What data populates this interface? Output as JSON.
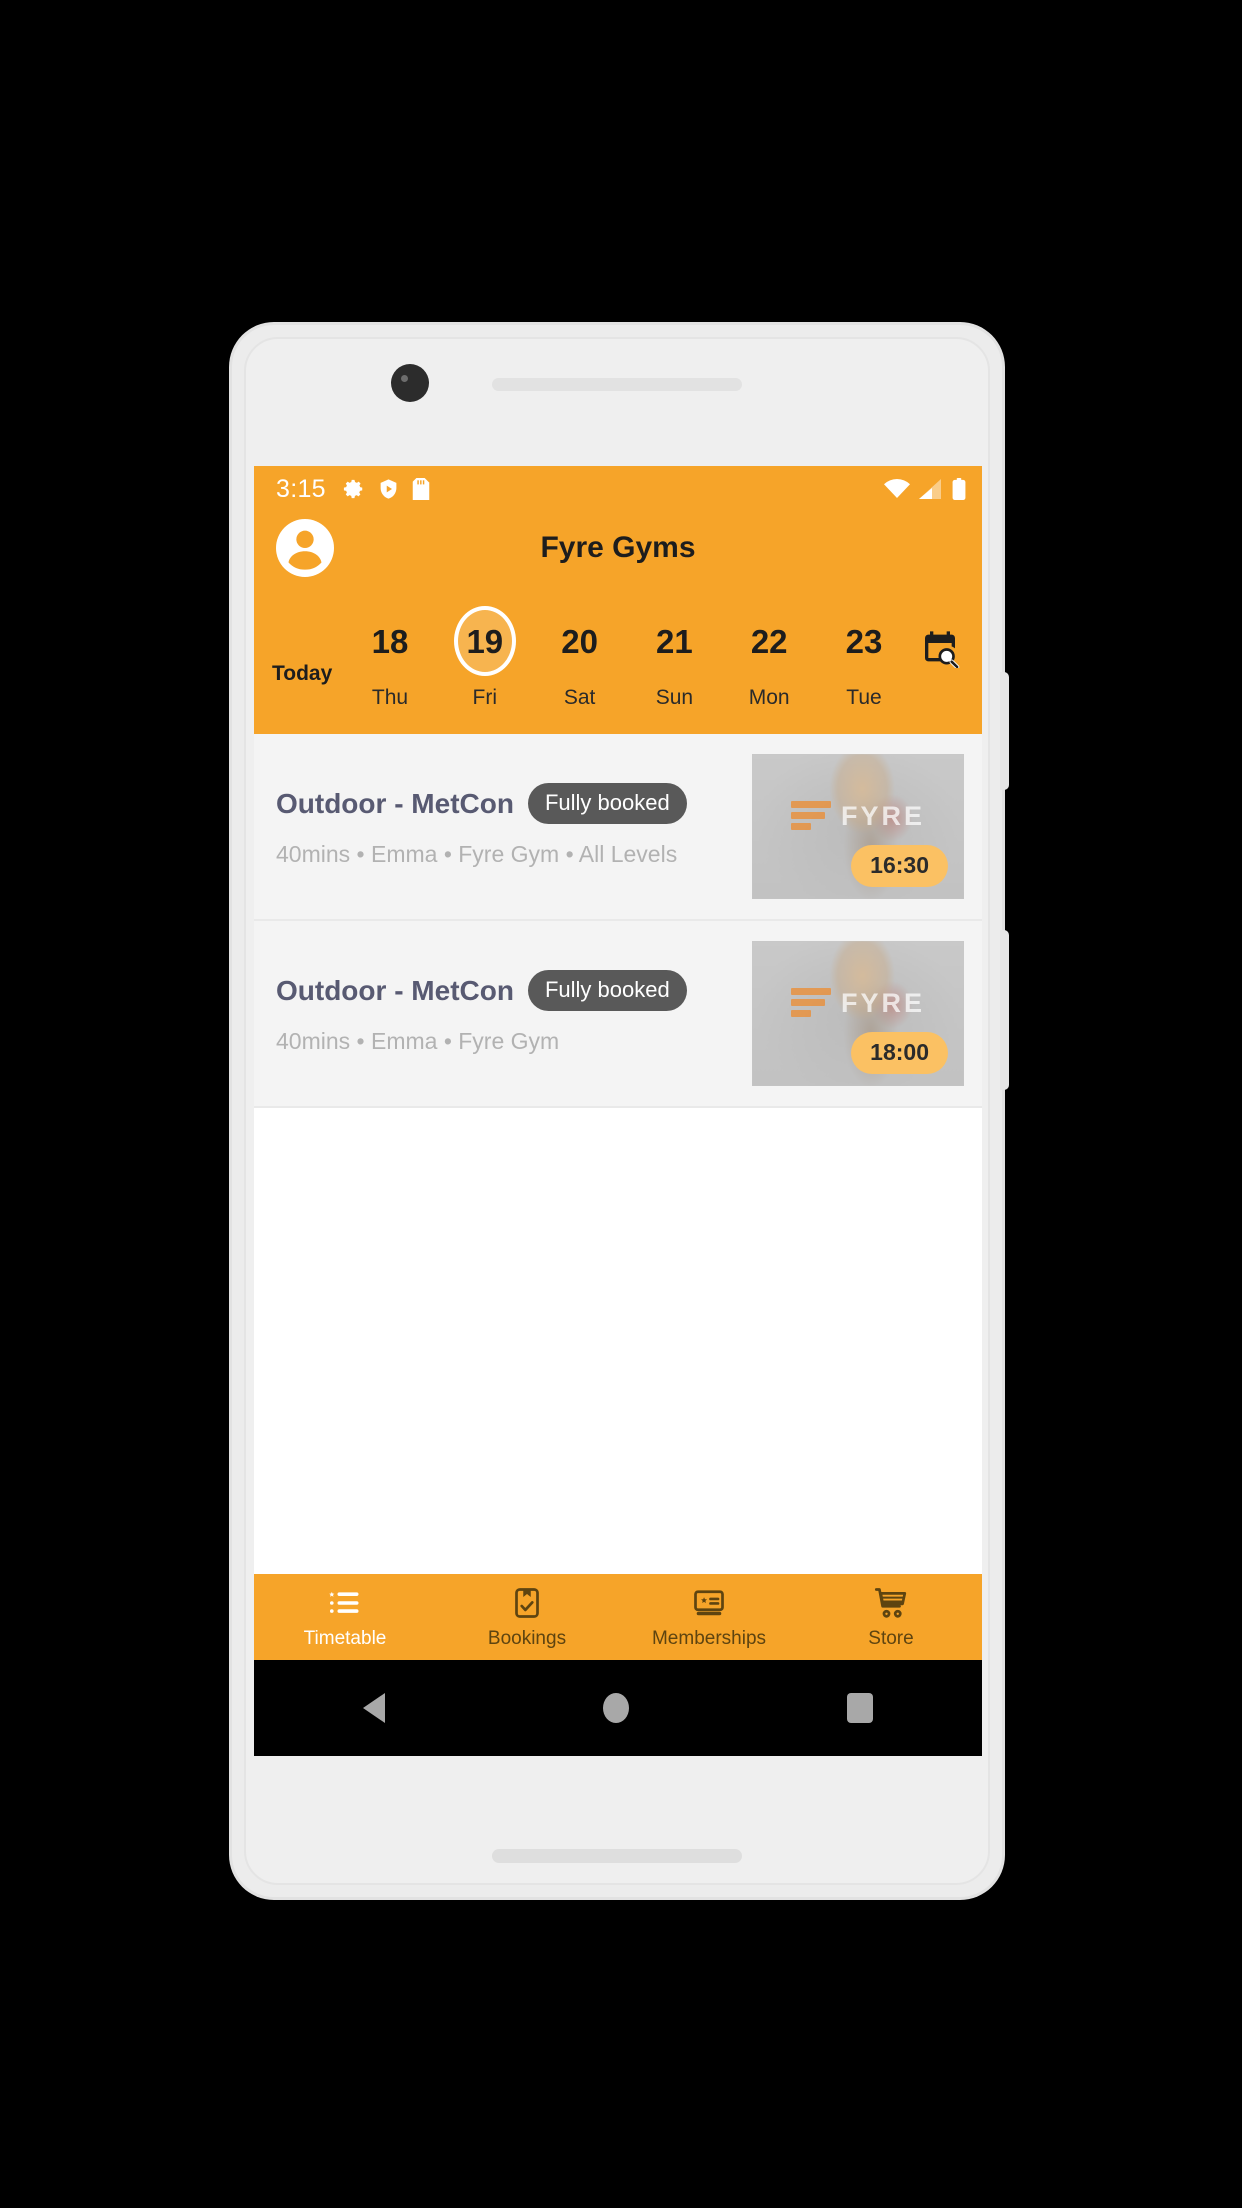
{
  "theme": {
    "brand_orange": "#f6a429",
    "badge_gray": "#595959",
    "title_purple": "#585a72",
    "time_badge_yellow": "#fbc163"
  },
  "status_bar": {
    "time": "3:15",
    "left_icons": [
      "gear-icon",
      "shield-play-icon",
      "sd-card-icon"
    ],
    "right_icons": [
      "wifi-icon",
      "cell-signal-icon",
      "battery-icon"
    ]
  },
  "app_bar": {
    "title": "Fyre Gyms",
    "avatar_icon": "person-avatar-icon"
  },
  "date_strip": {
    "today_label": "Today",
    "calendar_search_icon": "calendar-search-icon",
    "dates": [
      {
        "num": "18",
        "day": "Thu",
        "selected": false
      },
      {
        "num": "19",
        "day": "Fri",
        "selected": true
      },
      {
        "num": "20",
        "day": "Sat",
        "selected": false
      },
      {
        "num": "21",
        "day": "Sun",
        "selected": false
      },
      {
        "num": "22",
        "day": "Mon",
        "selected": false
      },
      {
        "num": "23",
        "day": "Tue",
        "selected": false
      }
    ]
  },
  "classes": [
    {
      "title": "Outdoor - MetCon",
      "badge": "Fully booked",
      "meta": "40mins • Emma • Fyre Gym • All Levels",
      "time": "16:30",
      "thumb_logo_text": "FYRE"
    },
    {
      "title": "Outdoor - MetCon",
      "badge": "Fully booked",
      "meta": "40mins • Emma • Fyre Gym",
      "time": "18:00",
      "thumb_logo_text": "FYRE"
    }
  ],
  "bottom_nav": [
    {
      "label": "Timetable",
      "icon": "list-star-icon",
      "active": true
    },
    {
      "label": "Bookings",
      "icon": "clipboard-check-icon",
      "active": false
    },
    {
      "label": "Memberships",
      "icon": "membership-card-icon",
      "active": false
    },
    {
      "label": "Store",
      "icon": "shopping-cart-icon",
      "active": false
    }
  ],
  "system_nav": {
    "back": "back-triangle-icon",
    "home": "home-circle-icon",
    "recents": "recents-square-icon"
  }
}
